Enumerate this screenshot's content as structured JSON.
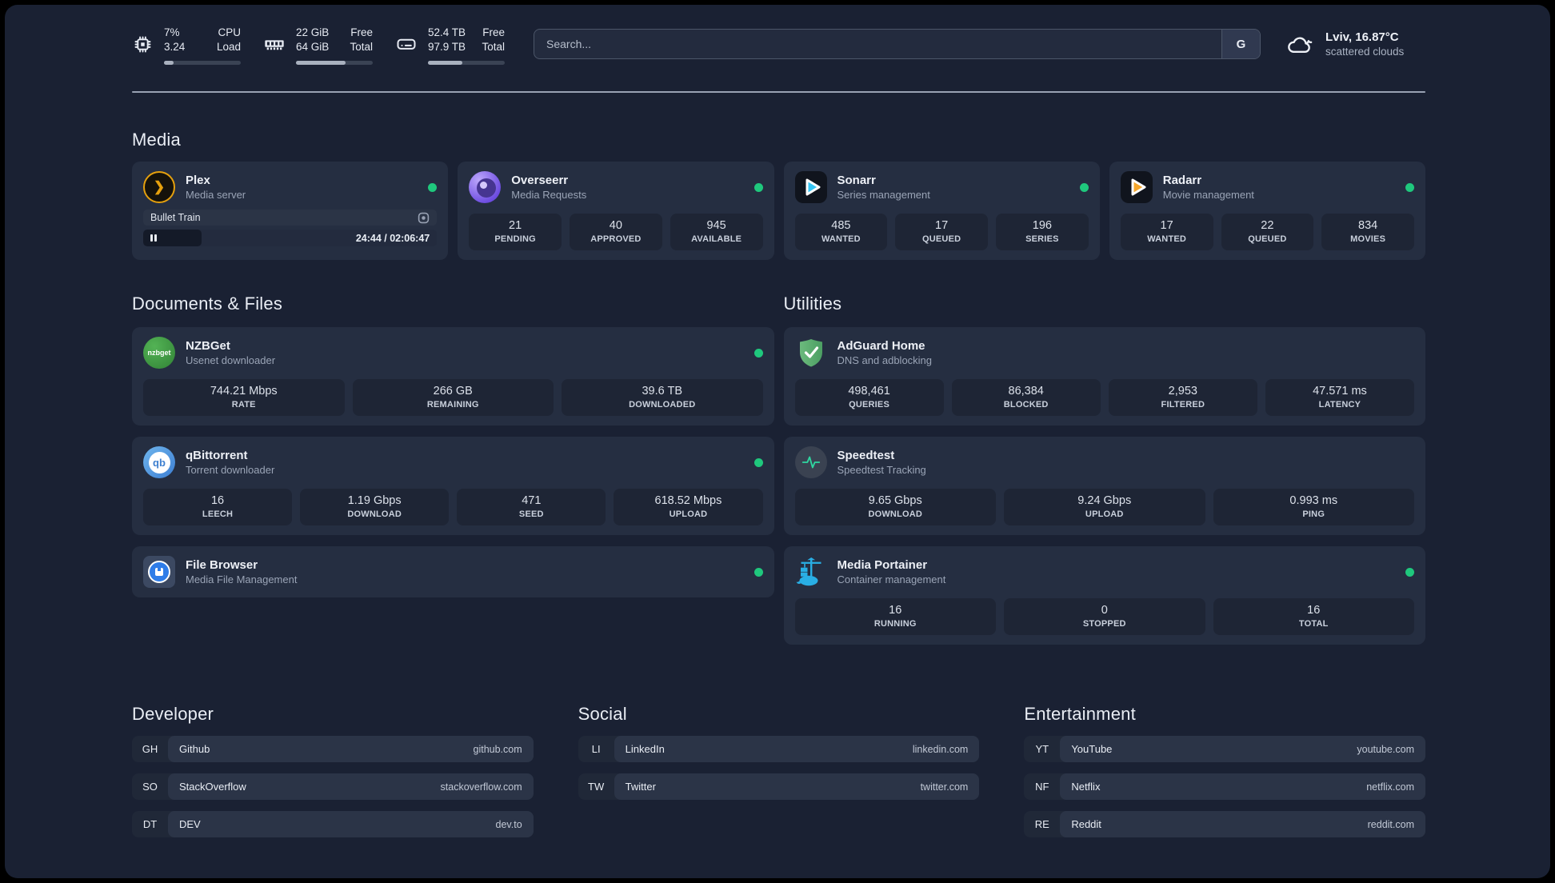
{
  "header": {
    "metrics": [
      {
        "values": [
          "7%",
          "3.24"
        ],
        "labels": [
          "CPU",
          "Load"
        ],
        "progress": "13%"
      },
      {
        "values": [
          "22 GiB",
          "64 GiB"
        ],
        "labels": [
          "Free",
          "Total"
        ],
        "progress": "65%"
      },
      {
        "values": [
          "52.4 TB",
          "97.9 TB"
        ],
        "labels": [
          "Free",
          "Total"
        ],
        "progress": "45%"
      }
    ],
    "search": {
      "placeholder": "Search...",
      "button": "G"
    },
    "weather": {
      "location": "Lviv, 16.87°C",
      "condition": "scattered clouds"
    }
  },
  "sections": {
    "media": {
      "title": "Media",
      "cards": [
        {
          "title": "Plex",
          "subtitle": "Media server",
          "online": true,
          "player": {
            "track": "Bullet Train",
            "time": "24:44 / 02:06:47",
            "progress": "20%"
          }
        },
        {
          "title": "Overseerr",
          "subtitle": "Media Requests",
          "online": true,
          "stats": [
            {
              "value": "21",
              "label": "PENDING"
            },
            {
              "value": "40",
              "label": "APPROVED"
            },
            {
              "value": "945",
              "label": "AVAILABLE"
            }
          ]
        },
        {
          "title": "Sonarr",
          "subtitle": "Series management",
          "online": true,
          "stats": [
            {
              "value": "485",
              "label": "WANTED"
            },
            {
              "value": "17",
              "label": "QUEUED"
            },
            {
              "value": "196",
              "label": "SERIES"
            }
          ]
        },
        {
          "title": "Radarr",
          "subtitle": "Movie management",
          "online": true,
          "stats": [
            {
              "value": "17",
              "label": "WANTED"
            },
            {
              "value": "22",
              "label": "QUEUED"
            },
            {
              "value": "834",
              "label": "MOVIES"
            }
          ]
        }
      ]
    },
    "documents": {
      "title": "Documents & Files",
      "cards": [
        {
          "title": "NZBGet",
          "subtitle": "Usenet downloader",
          "online": true,
          "icon_text": "nzbget",
          "stats": [
            {
              "value": "744.21 Mbps",
              "label": "RATE"
            },
            {
              "value": "266 GB",
              "label": "REMAINING"
            },
            {
              "value": "39.6 TB",
              "label": "DOWNLOADED"
            }
          ]
        },
        {
          "title": "qBittorrent",
          "subtitle": "Torrent downloader",
          "online": true,
          "icon_text": "qb",
          "stats": [
            {
              "value": "16",
              "label": "LEECH"
            },
            {
              "value": "1.19 Gbps",
              "label": "DOWNLOAD"
            },
            {
              "value": "471",
              "label": "SEED"
            },
            {
              "value": "618.52 Mbps",
              "label": "UPLOAD"
            }
          ]
        },
        {
          "title": "File Browser",
          "subtitle": "Media File Management",
          "online": true,
          "stats": []
        }
      ]
    },
    "utilities": {
      "title": "Utilities",
      "cards": [
        {
          "title": "AdGuard Home",
          "subtitle": "DNS and adblocking",
          "online": false,
          "stats": [
            {
              "value": "498,461",
              "label": "QUERIES"
            },
            {
              "value": "86,384",
              "label": "BLOCKED"
            },
            {
              "value": "2,953",
              "label": "FILTERED"
            },
            {
              "value": "47.571 ms",
              "label": "LATENCY"
            }
          ]
        },
        {
          "title": "Speedtest",
          "subtitle": "Speedtest Tracking",
          "online": false,
          "stats": [
            {
              "value": "9.65 Gbps",
              "label": "DOWNLOAD"
            },
            {
              "value": "9.24 Gbps",
              "label": "UPLOAD"
            },
            {
              "value": "0.993 ms",
              "label": "PING"
            }
          ]
        },
        {
          "title": "Media Portainer",
          "subtitle": "Container management",
          "online": true,
          "stats": [
            {
              "value": "16",
              "label": "RUNNING"
            },
            {
              "value": "0",
              "label": "STOPPED"
            },
            {
              "value": "16",
              "label": "TOTAL"
            }
          ]
        }
      ]
    },
    "bookmarks": [
      {
        "title": "Developer",
        "items": [
          {
            "abbr": "GH",
            "name": "Github",
            "url": "github.com"
          },
          {
            "abbr": "SO",
            "name": "StackOverflow",
            "url": "stackoverflow.com"
          },
          {
            "abbr": "DT",
            "name": "DEV",
            "url": "dev.to"
          }
        ]
      },
      {
        "title": "Social",
        "items": [
          {
            "abbr": "LI",
            "name": "LinkedIn",
            "url": "linkedin.com"
          },
          {
            "abbr": "TW",
            "name": "Twitter",
            "url": "twitter.com"
          }
        ]
      },
      {
        "title": "Entertainment",
        "items": [
          {
            "abbr": "YT",
            "name": "YouTube",
            "url": "youtube.com"
          },
          {
            "abbr": "NF",
            "name": "Netflix",
            "url": "netflix.com"
          },
          {
            "abbr": "RE",
            "name": "Reddit",
            "url": "reddit.com"
          }
        ]
      }
    ]
  },
  "colors": {
    "status_online": "#1FC87D",
    "accent_plex": "#E5A00D"
  }
}
